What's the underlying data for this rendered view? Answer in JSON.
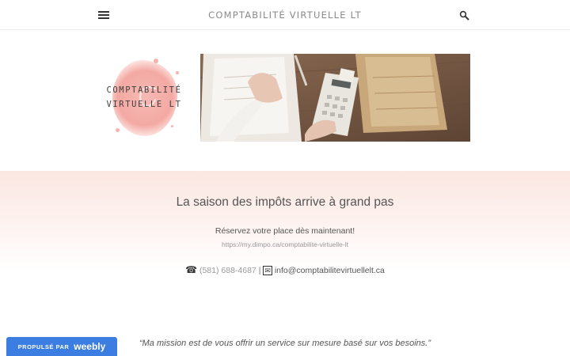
{
  "header": {
    "site_title": "COMPTABILITÉ VIRTUELLE LT",
    "menu_icon": "hamburger-menu-icon",
    "search_icon": "search-icon"
  },
  "logo": {
    "line1": "COMPTABILITÉ",
    "line2": "VIRTUELLE LT",
    "color": "#f4a9a3"
  },
  "hero": {
    "image": "desk-calculator-photo"
  },
  "banner": {
    "title": "La saison des impôts arrive à grand pas",
    "subtitle": "Réservez votre place dès maintenant!",
    "link": "https://my.dimpo.ca/comptabilite-virtuelle-lt",
    "phone_icon": "☎",
    "phone": "(581) 688-4687",
    "separator": "|",
    "mail_icon": "✉",
    "email": "info@comptabilitevirtuellelt.ca"
  },
  "quote": "“Ma mission est de vous offrir un service sur mesure basé sur vos besoins.”",
  "badge": {
    "prefix": "PROPULSÉ PAR",
    "brand": "weebly",
    "color": "#3b7de0"
  }
}
